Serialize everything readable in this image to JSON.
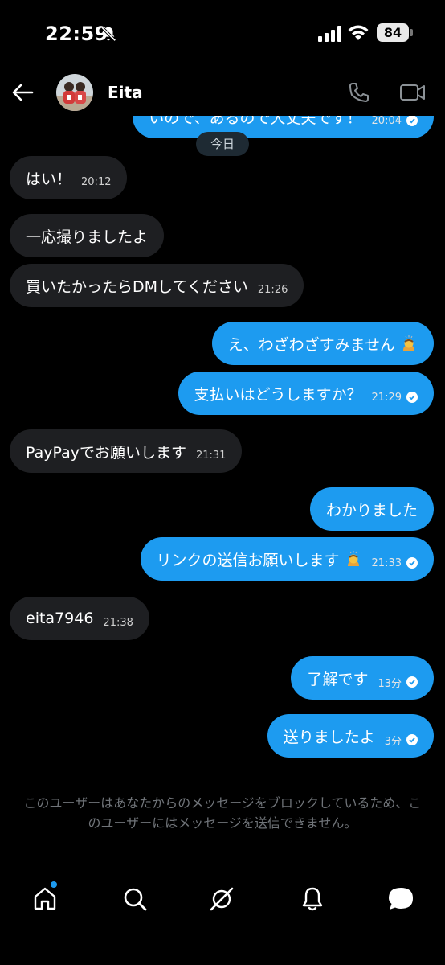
{
  "status_bar": {
    "time": "22:59",
    "battery": "84",
    "icons": [
      "bell-off-icon",
      "signal-icon",
      "wifi-icon",
      "battery-icon"
    ]
  },
  "header": {
    "contact_name": "Eita",
    "icons": [
      "back-arrow-icon",
      "phone-icon",
      "video-icon"
    ]
  },
  "date_separator": "今日",
  "messages": [
    {
      "side": "out",
      "text": "いので、あるので大丈夫です！",
      "time": "20:04",
      "read": true
    },
    {
      "side": "in",
      "text": "はい！",
      "time": "20:12"
    },
    {
      "side": "in",
      "text": "一応撮りましたよ",
      "time": ""
    },
    {
      "side": "in",
      "text": "買いたかったらDMしてください",
      "time": "21:26"
    },
    {
      "side": "out",
      "text": "え、わざわざすみません",
      "time": "",
      "emoji": "bowing-person-emoji"
    },
    {
      "side": "out",
      "text": "支払いはどうしますか？",
      "time": "21:29",
      "read": true
    },
    {
      "side": "in",
      "text": "PayPayでお願いします",
      "time": "21:31"
    },
    {
      "side": "out",
      "text": "わかりました",
      "time": ""
    },
    {
      "side": "out",
      "text": "リンクの送信お願いします",
      "time": "21:33",
      "read": true,
      "emoji": "bowing-person-emoji"
    },
    {
      "side": "in",
      "text": "eita7946",
      "time": "21:38"
    },
    {
      "side": "out",
      "text": "了解です",
      "time": "13分",
      "read": true
    },
    {
      "side": "out",
      "text": "送りましたよ",
      "time": "3分",
      "read": true
    }
  ],
  "block_notice": "このユーザーはあなたからのメッセージをブロックしているため、このユーザーにはメッセージを送信できません。",
  "bottom_nav": {
    "items": [
      "home-icon",
      "search-icon",
      "grok-icon",
      "notifications-icon",
      "messages-icon"
    ]
  },
  "colors": {
    "background": "#000000",
    "outgoing_bubble": "#1d9bf0",
    "incoming_bubble": "#1e1f22",
    "notice_text": "#707479"
  }
}
